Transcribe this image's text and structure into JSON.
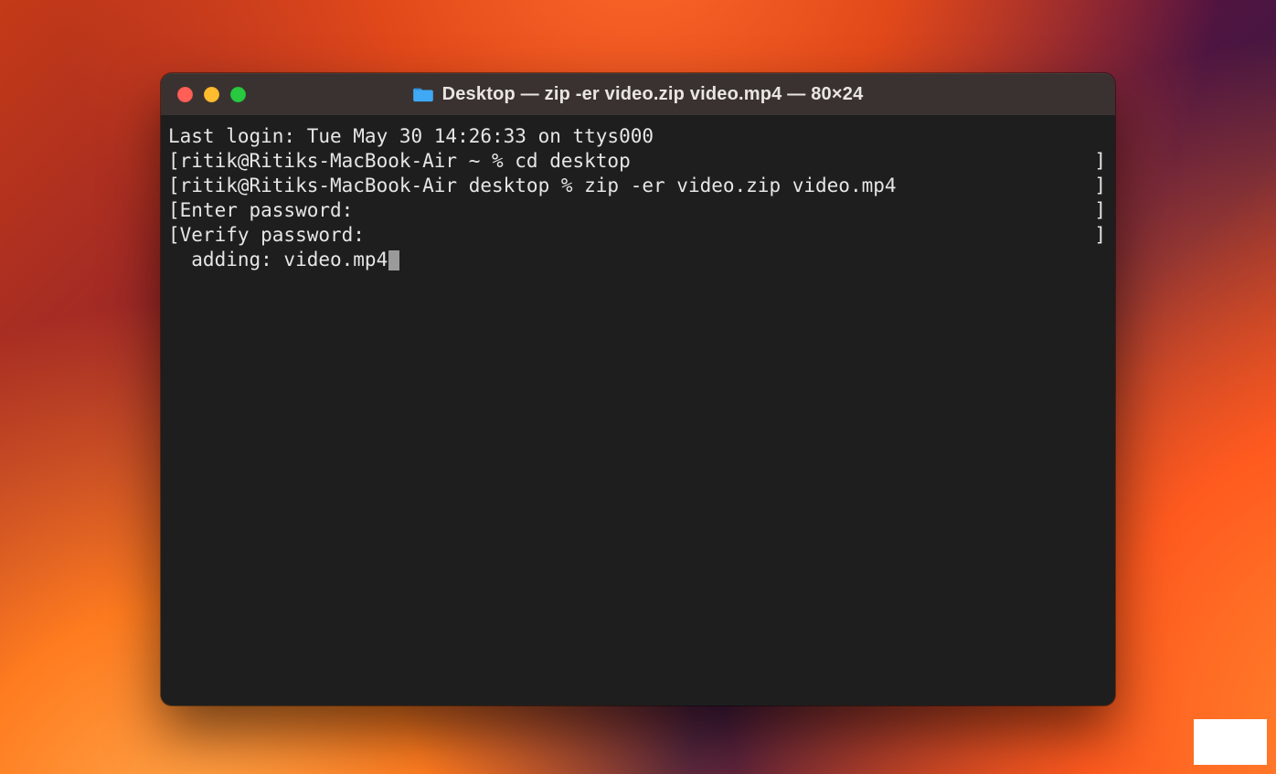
{
  "window": {
    "title": "Desktop — zip -er video.zip video.mp4 — 80×24",
    "folder_icon_name": "folder-icon"
  },
  "terminal": {
    "lines": [
      {
        "left": "Last login: Tue May 30 14:26:33 on ttys000",
        "right": ""
      },
      {
        "left": "[ritik@Ritiks-MacBook-Air ~ % cd desktop",
        "right": "]"
      },
      {
        "left": "[ritik@Ritiks-MacBook-Air desktop % zip -er video.zip video.mp4",
        "right": "]"
      },
      {
        "left": "[Enter password:",
        "right": "]"
      },
      {
        "left": "[Verify password:",
        "right": "]"
      },
      {
        "left": "  adding: video.mp4",
        "right": "",
        "cursor": true
      }
    ]
  }
}
